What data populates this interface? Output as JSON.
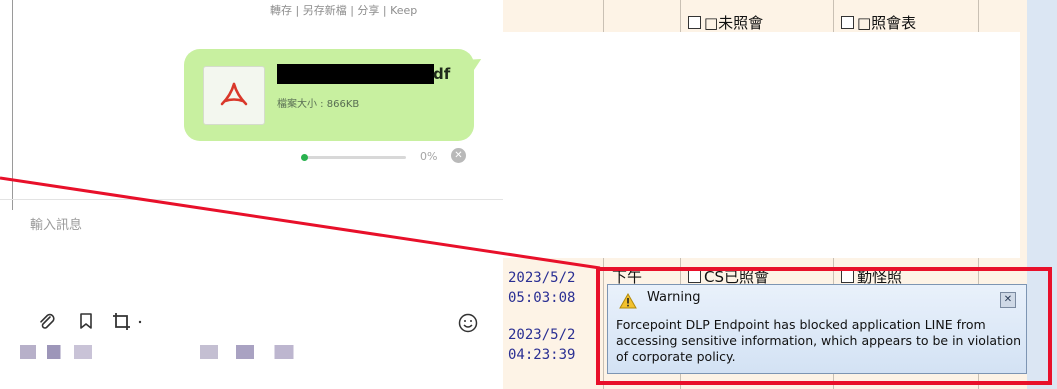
{
  "chat": {
    "top_links": "轉存 | 另存新檔 | 分享 | Keep",
    "file_ext": "df",
    "file_size": "檔案大小 : 866KB",
    "progress_text": "0%",
    "progress_value": 0,
    "input_placeholder": "輸入訊息"
  },
  "sheet": {
    "header_cells": [
      "□未照會",
      "□照會表"
    ],
    "mid_cells": [
      "CS已照會",
      "勤怪照"
    ],
    "row1_time": "下午",
    "dates": [
      {
        "date": "2023/5/2",
        "time": "05:03:08"
      },
      {
        "date": "2023/5/2",
        "time": "04:23:39"
      }
    ]
  },
  "warning": {
    "title": "Warning",
    "message": "Forcepoint DLP Endpoint has blocked application LINE from accessing sensitive information, which appears to be in violation of corporate policy.",
    "close_label": "✕"
  },
  "colors": {
    "bubble": "#c8f0a0",
    "progress": "#29b24f",
    "alert_frame": "#e8102a",
    "arrow": "#e8102a"
  }
}
